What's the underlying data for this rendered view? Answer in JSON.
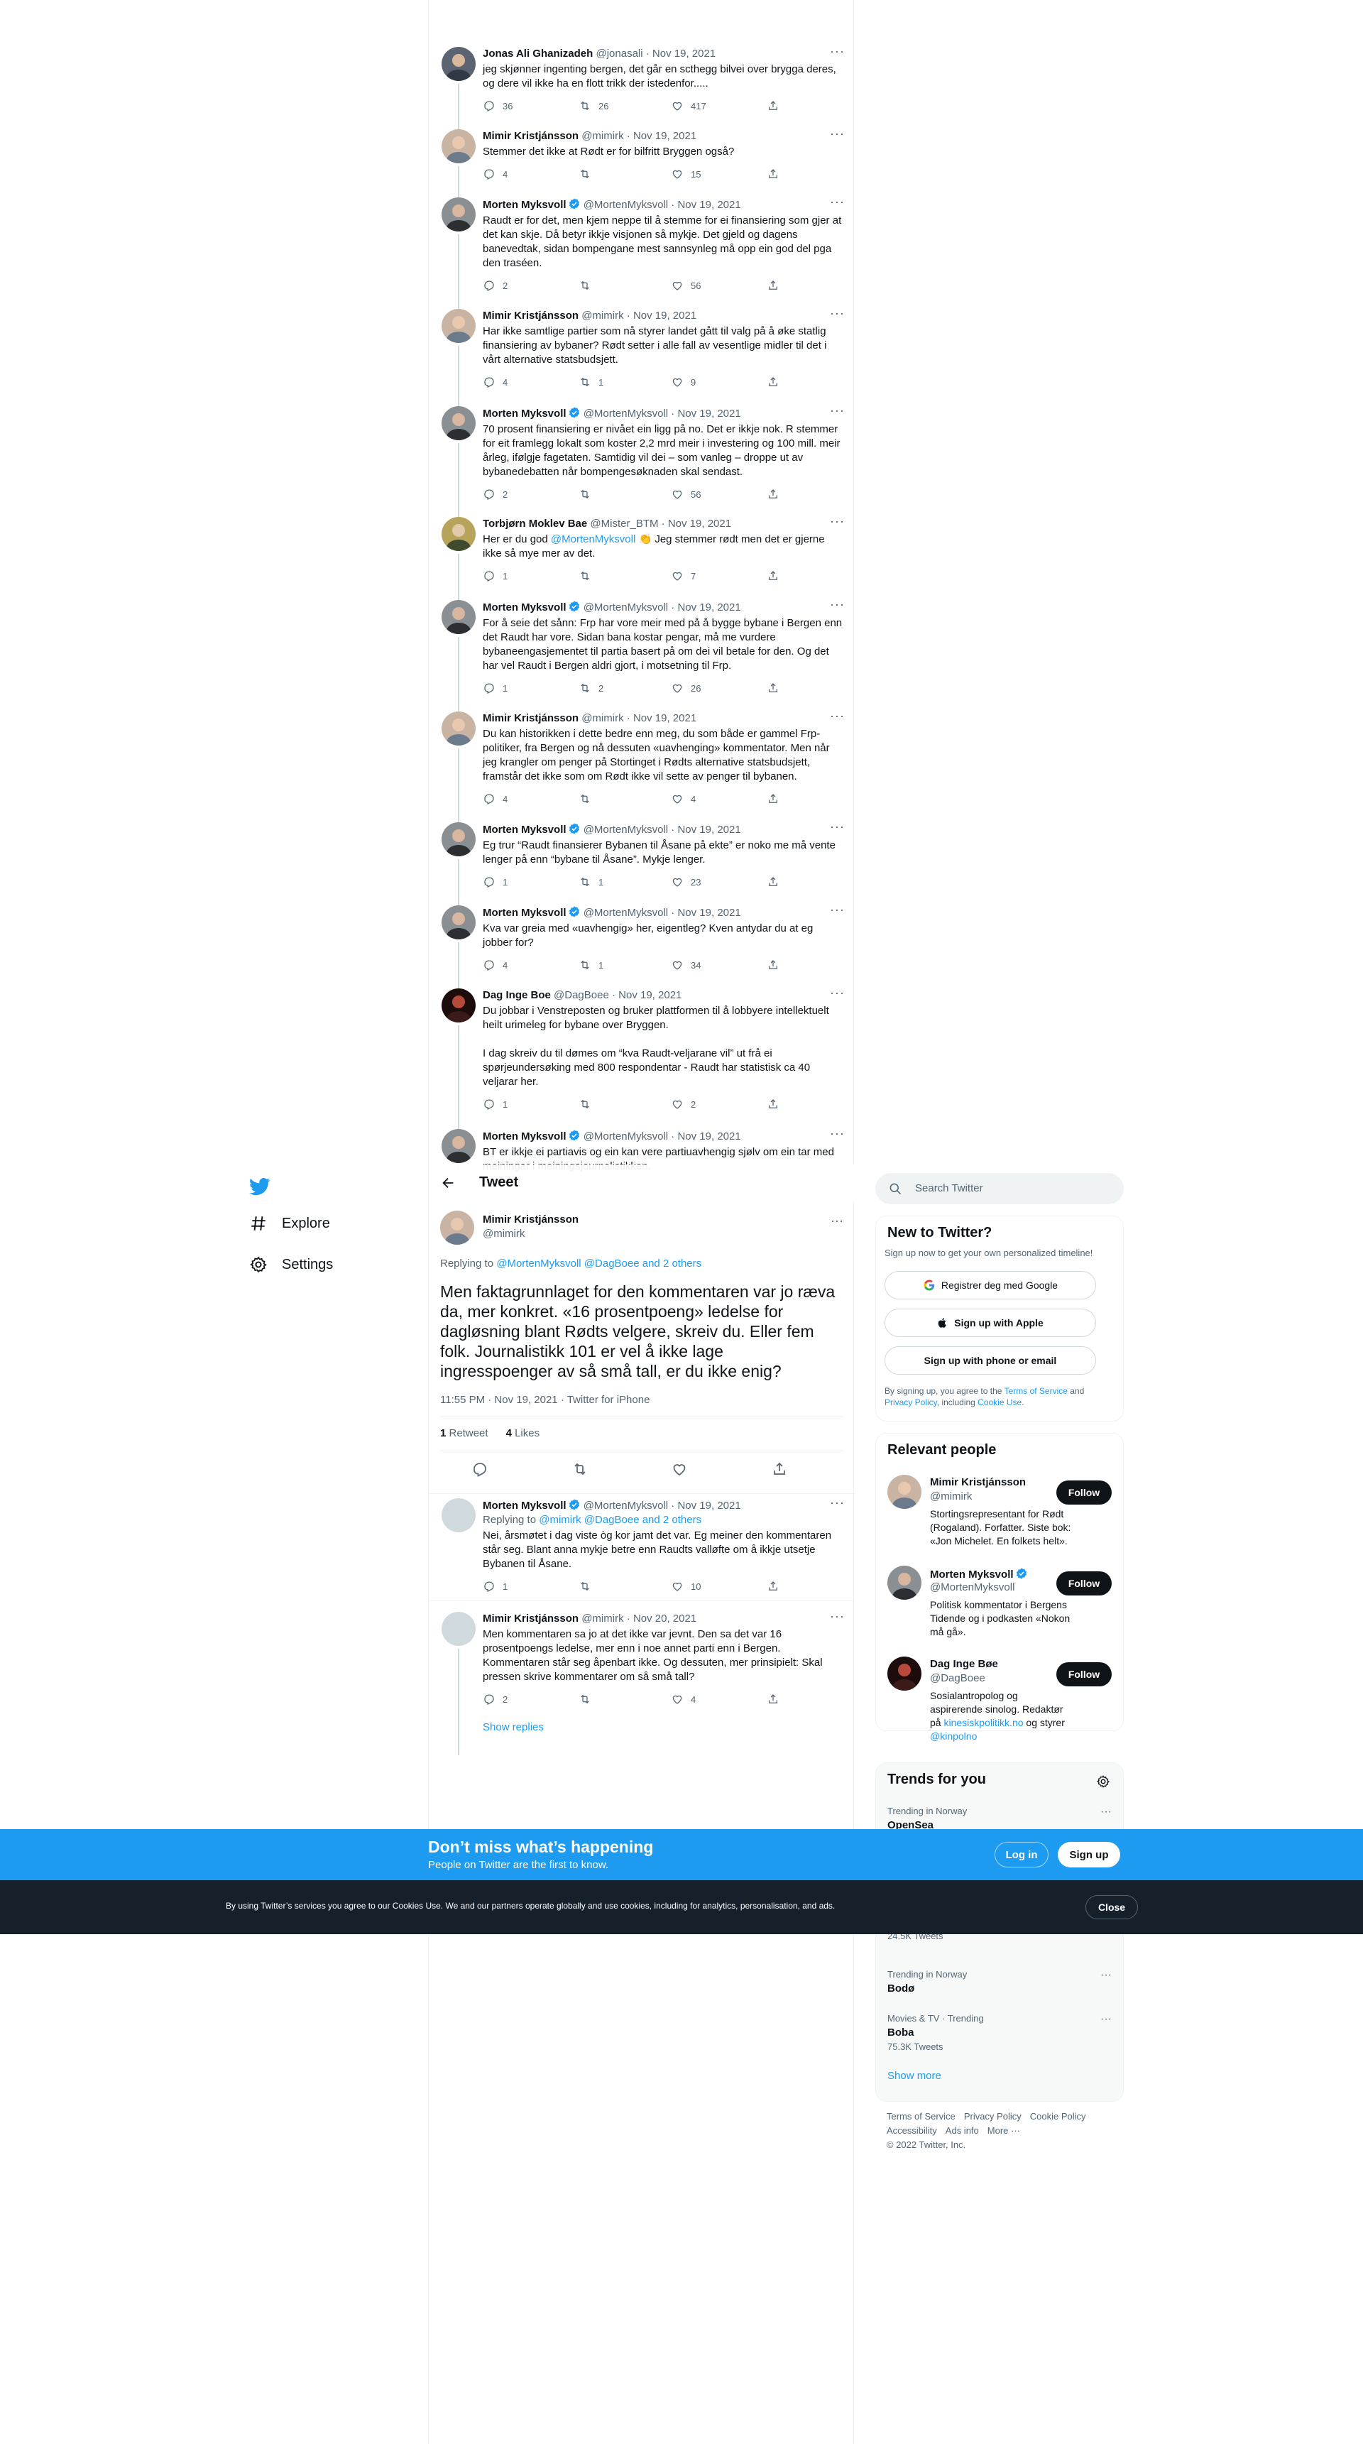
{
  "thread": [
    {
      "name": "Jonas Ali Ghanizadeh",
      "handle": "@jonasali",
      "date": "Nov 19, 2021",
      "verified": false,
      "text": "jeg skjønner ingenting bergen, det går en scthegg bilvei over brygga deres, og dere vil ikke ha en flott trikk der istedenfor.....",
      "replies": "36",
      "retweets": "26",
      "likes": "417"
    },
    {
      "name": "Mimir Kristjánsson",
      "handle": "@mimirk",
      "date": "Nov 19, 2021",
      "verified": false,
      "text": "Stemmer det ikke at Rødt er for bilfritt Bryggen også?",
      "replies": "4",
      "retweets": "",
      "likes": "15"
    },
    {
      "name": "Morten Myksvoll",
      "handle": "@MortenMyksvoll",
      "date": "Nov 19, 2021",
      "verified": true,
      "text": "Raudt er for det, men kjem neppe til å stemme for ei finansiering som gjer at det kan skje. Då betyr ikkje visjonen så mykje. Det gjeld og dagens banevedtak, sidan bompengane mest sannsynleg må opp ein god del pga den traséen.",
      "replies": "2",
      "retweets": "",
      "likes": "56"
    },
    {
      "name": "Mimir Kristjánsson",
      "handle": "@mimirk",
      "date": "Nov 19, 2021",
      "verified": false,
      "text": "Har ikke samtlige partier som nå styrer landet gått til valg på å øke statlig finansiering av bybaner? Rødt setter i alle fall av vesentlige midler til det i vårt alternative statsbudsjett.",
      "replies": "4",
      "retweets": "1",
      "likes": "9"
    },
    {
      "name": "Morten Myksvoll",
      "handle": "@MortenMyksvoll",
      "date": "Nov 19, 2021",
      "verified": true,
      "text": "70 prosent finansiering er nivået ein ligg på no. Det er ikkje nok. R stemmer for eit framlegg lokalt som koster 2,2 mrd meir i investering og 100 mill. meir årleg, ifølgje fagetaten. Samtidig vil dei – som vanleg – droppe ut av bybanedebatten når bompengesøknaden skal sendast.",
      "replies": "2",
      "retweets": "",
      "likes": "56"
    },
    {
      "name": "Torbjørn Moklev Bae",
      "handle": "@Mister_BTM",
      "date": "Nov 19, 2021",
      "verified": false,
      "text_pre": "Her er du god ",
      "mention": "@MortenMyksvoll",
      "text_post": " 👏 Jeg stemmer rødt men det er gjerne ikke så mye mer av det.",
      "replies": "1",
      "retweets": "",
      "likes": "7"
    },
    {
      "name": "Morten Myksvoll",
      "handle": "@MortenMyksvoll",
      "date": "Nov 19, 2021",
      "verified": true,
      "text": "For å seie det sånn: Frp har vore meir med på å bygge bybane i Bergen enn det Raudt har vore. Sidan bana kostar pengar, må me vurdere bybaneengasjementet til partia basert på om dei vil betale for den. Og det har vel Raudt i Bergen aldri gjort, i motsetning til Frp.",
      "replies": "1",
      "retweets": "2",
      "likes": "26"
    },
    {
      "name": "Mimir Kristjánsson",
      "handle": "@mimirk",
      "date": "Nov 19, 2021",
      "verified": false,
      "text": "Du kan historikken i dette bedre enn meg, du som både er gammel Frp-politiker, fra Bergen og nå dessuten «uavhenging» kommentator. Men når jeg krangler om penger på Stortinget i Rødts alternative statsbudsjett, framstår det ikke som om Rødt ikke vil sette av penger til bybanen.",
      "replies": "4",
      "retweets": "",
      "likes": "4"
    },
    {
      "name": "Morten Myksvoll",
      "handle": "@MortenMyksvoll",
      "date": "Nov 19, 2021",
      "verified": true,
      "text": "Eg trur “Raudt finansierer Bybanen til Åsane på ekte” er noko me må vente lenger på enn “bybane til Åsane”. Mykje lenger.",
      "replies": "1",
      "retweets": "1",
      "likes": "23"
    },
    {
      "name": "Morten Myksvoll",
      "handle": "@MortenMyksvoll",
      "date": "Nov 19, 2021",
      "verified": true,
      "text": "Kva var greia med «uavhengig» her, eigentleg? Kven antydar du at eg jobber for?",
      "replies": "4",
      "retweets": "1",
      "likes": "34"
    },
    {
      "name": "Dag Inge Boe",
      "handle": "@DagBoee",
      "date": "Nov 19, 2021",
      "verified": false,
      "text": "Du jobbar i Venstreposten og bruker plattformen til å lobbyere  intellektuelt heilt urimeleg for bybane over Bryggen.\n\nI dag skreiv du til dømes om “kva Raudt-veljarane vil” ut frå ei spørjeundersøking med 800 respondentar - Raudt har statistisk ca  40 veljarar her.",
      "replies": "1",
      "retweets": "",
      "likes": "2"
    },
    {
      "name": "Morten Myksvoll",
      "handle": "@MortenMyksvoll",
      "date": "Nov 19, 2021",
      "verified": true,
      "text": "BT er ikkje ei partiavis og ein kan vere partiuavhengig sjølv om ein tar med meiningar i meiningsjournalistikken.",
      "replies": "",
      "retweets": "",
      "likes": ""
    }
  ],
  "header": {
    "title": "Tweet"
  },
  "focus": {
    "name": "Mimir Kristjánsson",
    "handle": "@mimirk",
    "replying_label": "Replying to ",
    "replying_links": "@MortenMyksvoll @DagBoee and 2 others",
    "text": "Men faktagrunnlaget for den kommentaren var jo ræva da, mer konkret. «16 prosentpoeng» ledelse for dagløsning blant Rødts velgere, skreiv du. Eller fem folk. Journalistikk 101 er vel å ikke lage ingresspoenger av så små tall, er du ikke enig?",
    "time": "11:55 PM · Nov 19, 2021 · Twitter for iPhone",
    "retweets_count": "1",
    "retweets_label": "Retweet",
    "likes_count": "4",
    "likes_label": "Likes"
  },
  "replies": [
    {
      "name": "Morten Myksvoll",
      "handle": "@MortenMyksvoll",
      "date": "Nov 19, 2021",
      "verified": true,
      "replying_label": "Replying to ",
      "replying_links": "@mimirk @DagBoee and 2 others",
      "text": "Nei, årsmøtet i dag viste òg kor jamt det var. Eg meiner den kommentaren står seg. Blant anna mykje betre enn Raudts valløfte om å ikkje utsetje Bybanen til Åsane.",
      "replies": "1",
      "retweets": "",
      "likes": "10"
    },
    {
      "name": "Mimir Kristjánsson",
      "handle": "@mimirk",
      "date": "Nov 20, 2021",
      "verified": false,
      "text": "Men kommentaren sa jo at det ikke var jevnt. Den sa det var 16 prosentpoengs ledelse, mer enn i noe annet parti enn i Bergen. Kommentaren står seg åpenbart ikke. Og dessuten, mer prinsipielt: Skal pressen skrive kommentarer om så små tall?",
      "replies": "2",
      "retweets": "",
      "likes": "4"
    }
  ],
  "show_replies": "Show replies",
  "nav": {
    "explore": "Explore",
    "settings": "Settings"
  },
  "search": {
    "placeholder": "Search Twitter"
  },
  "new_to_twitter": {
    "title": "New to Twitter?",
    "subtitle": "Sign up now to get your own personalized timeline!",
    "google": "Registrer deg med Google",
    "apple": "Sign up with Apple",
    "phone": "Sign up with phone or email",
    "terms_pre": "By signing up, you agree to the ",
    "terms": "Terms of Service",
    "terms_and": " and ",
    "privacy": "Privacy Policy",
    "terms_incl": ", including ",
    "cookie": "Cookie Use",
    "terms_end": "."
  },
  "relevant_people": {
    "title": "Relevant people",
    "follow_label": "Follow",
    "people": [
      {
        "name": "Mimir Kristjánsson",
        "handle": "@mimirk",
        "verified": false,
        "bio": "Stortingsrepresentant for Rødt (Rogaland). Forfatter. Siste bok: «Jon Michelet. En folkets helt»."
      },
      {
        "name": "Morten Myksvoll",
        "handle": "@MortenMyksvoll",
        "verified": true,
        "bio": "Politisk kommentator i Bergens Tidende og i podkasten «Nokon må gå»."
      },
      {
        "name": "Dag Inge Bøe",
        "handle": "@DagBoee",
        "verified": false,
        "bio_pre": "Sosialantropolog og aspirerende sinolog. Redaktør på ",
        "bio_link1": "kinesiskpolitikk.no",
        "bio_mid": " og styrer ",
        "bio_link2": "@kinpolno"
      }
    ]
  },
  "trends": {
    "title": "Trends for you",
    "items": [
      {
        "context": "Trending in Norway",
        "name": "OpenSea",
        "count": ""
      },
      {
        "context": "",
        "name": "",
        "count": "24.5K Tweets"
      },
      {
        "context": "Trending in Norway",
        "name": "Bodø",
        "count": ""
      },
      {
        "context": "Movies & TV · Trending",
        "name": "Boba",
        "count": "75.3K Tweets"
      }
    ],
    "show_more": "Show more"
  },
  "footer": {
    "links": [
      "Terms of Service",
      "Privacy Policy",
      "Cookie Policy",
      "Accessibility",
      "Ads info",
      "More ···"
    ],
    "copyright": "© 2022 Twitter, Inc."
  },
  "signup_bar": {
    "title": "Don’t miss what’s happening",
    "subtitle": "People on Twitter are the first to know.",
    "login": "Log in",
    "signup": "Sign up"
  },
  "cookie_bar": {
    "message": "By using Twitter’s services you agree to our Cookies Use. We and our partners operate globally and use cookies, including for analytics, personalisation, and ads.",
    "close": "Close"
  },
  "colors": {
    "accent": "#1d9bf0",
    "text": "#0f1419",
    "muted": "#536471",
    "cookie_bg": "#15202b"
  }
}
